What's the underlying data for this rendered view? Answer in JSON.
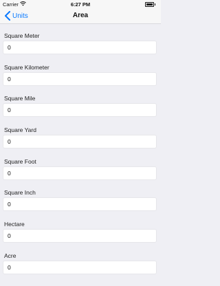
{
  "status_bar": {
    "carrier": "Carrier",
    "time": "6:27 PM"
  },
  "nav": {
    "back_label": "Units",
    "title": "Area"
  },
  "units": [
    {
      "label": "Square Meter",
      "value": "0"
    },
    {
      "label": "Square Kilometer",
      "value": "0"
    },
    {
      "label": "Square Mile",
      "value": "0"
    },
    {
      "label": "Square Yard",
      "value": "0"
    },
    {
      "label": "Square Foot",
      "value": "0"
    },
    {
      "label": "Square Inch",
      "value": "0"
    },
    {
      "label": "Hectare",
      "value": "0"
    },
    {
      "label": "Acre",
      "value": "0"
    }
  ],
  "icons": {
    "back": "chevron-left-icon",
    "wifi": "wifi-icon",
    "battery": "battery-icon"
  },
  "colors": {
    "accent": "#0a7aff",
    "background": "#efeff4"
  }
}
